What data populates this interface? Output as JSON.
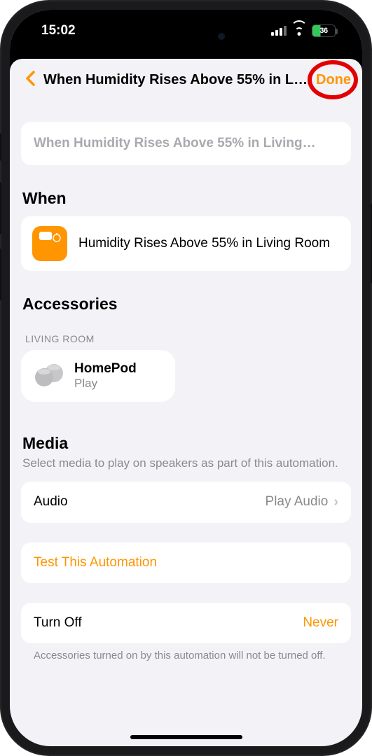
{
  "status": {
    "time": "15:02",
    "battery": "36"
  },
  "nav": {
    "title": "When Humidity Rises Above 55% in L…",
    "done": "Done"
  },
  "name_field": {
    "placeholder": "When Humidity Rises Above 55% in Living…"
  },
  "sections": {
    "when": {
      "title": "When",
      "trigger_text": "Humidity Rises Above 55% in Living Room"
    },
    "accessories": {
      "title": "Accessories",
      "group_label": "LIVING ROOM",
      "item": {
        "name": "HomePod",
        "state": "Play"
      }
    },
    "media": {
      "title": "Media",
      "description": "Select media to play on speakers as part of this automation.",
      "row_label": "Audio",
      "row_value": "Play Audio"
    },
    "test": {
      "label": "Test This Automation"
    },
    "turnoff": {
      "label": "Turn Off",
      "value": "Never",
      "footnote": "Accessories turned on by this automation will not be turned off."
    }
  }
}
